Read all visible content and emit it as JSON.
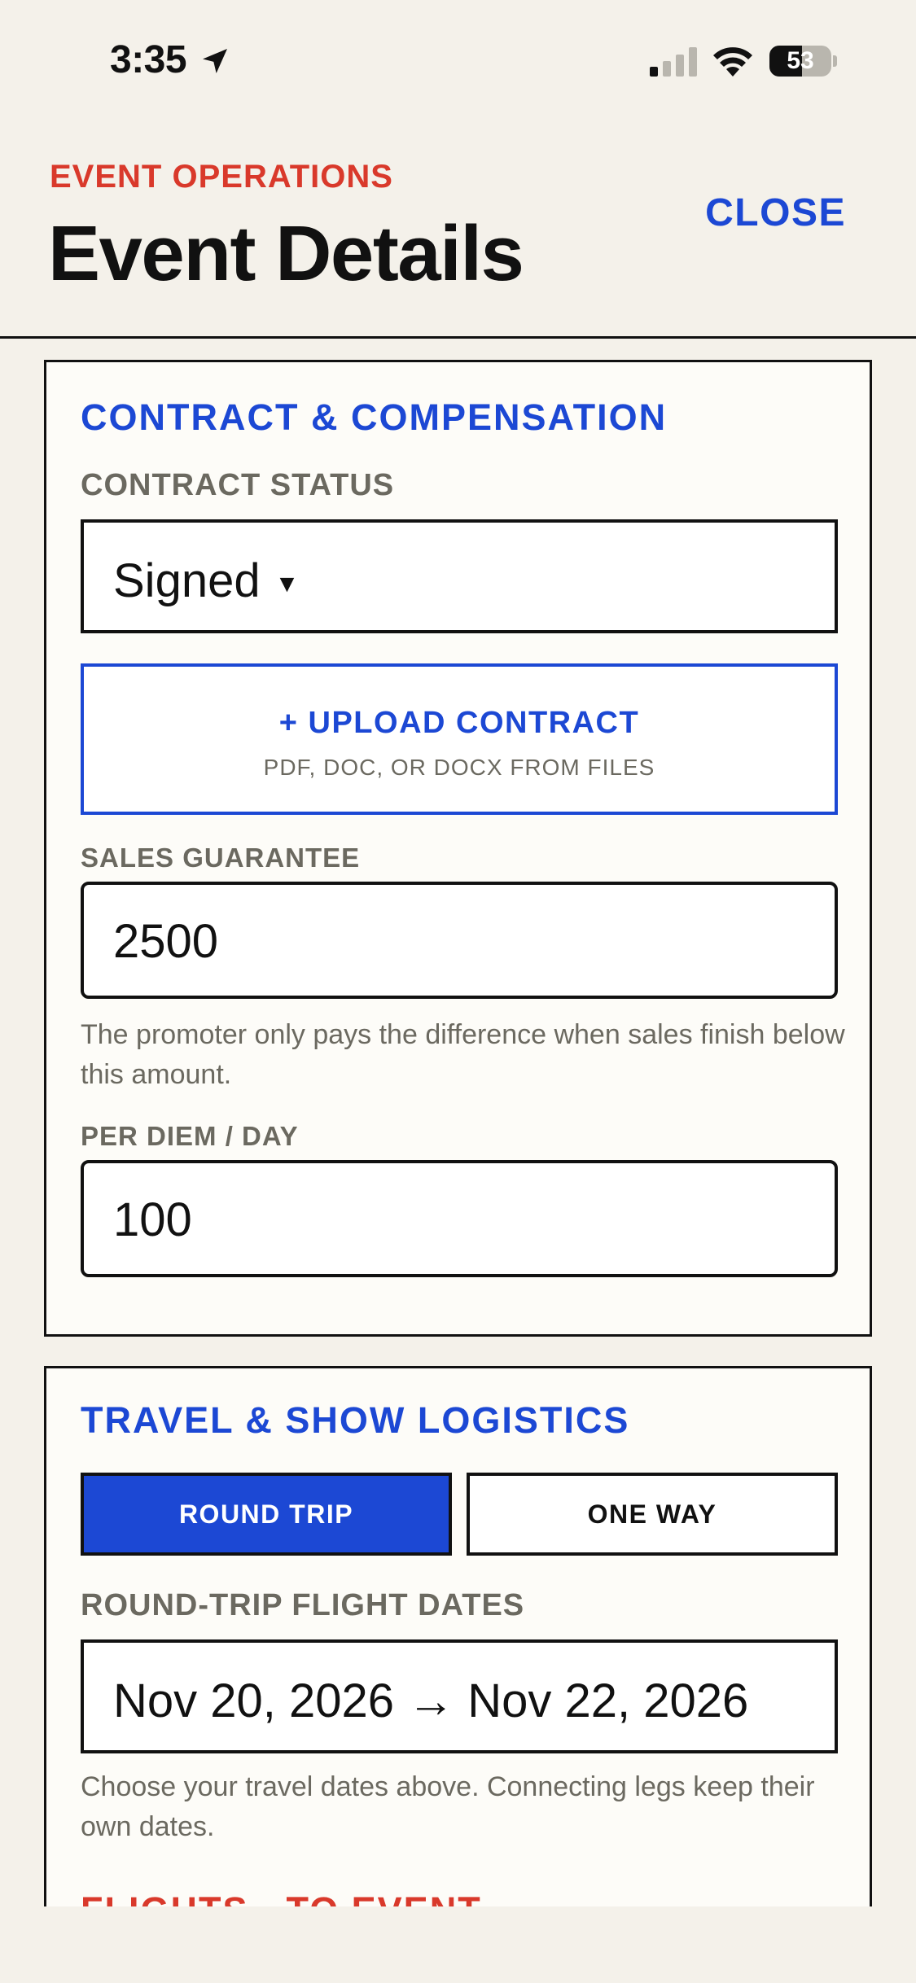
{
  "status_bar": {
    "time": "3:35",
    "battery": "53",
    "battery_level": 0.53,
    "icons": [
      "location-arrow-icon",
      "cellular-signal-icon",
      "wifi-icon",
      "battery-icon"
    ]
  },
  "header": {
    "eyebrow": "EVENT OPERATIONS",
    "title": "Event Details",
    "close_label": "CLOSE"
  },
  "contract": {
    "section_title": "CONTRACT & COMPENSATION",
    "status_label": "CONTRACT STATUS",
    "status_value": "Signed",
    "upload_title": "+ UPLOAD CONTRACT",
    "upload_subtitle": "PDF, DOC, OR DOCX FROM FILES",
    "guarantee_label": "SALES GUARANTEE",
    "guarantee_value": "2500",
    "guarantee_helper": "The promoter only pays the difference when sales finish below this amount.",
    "per_diem_label": "PER DIEM / DAY",
    "per_diem_value": "100"
  },
  "travel": {
    "section_title": "TRAVEL & SHOW LOGISTICS",
    "round_trip_label": "ROUND TRIP",
    "one_way_label": "ONE WAY",
    "selected_trip_type": "ROUND TRIP",
    "dates_label": "ROUND-TRIP FLIGHT DATES",
    "dates_value": "Nov 20, 2026 → Nov 22, 2026",
    "dates_helper": "Choose your travel dates above. Connecting legs keep their own dates.",
    "flights_heading": "FLIGHTS · TO EVENT"
  },
  "colors": {
    "accent_blue": "#1c48d4",
    "accent_red": "#d9392b",
    "background": "#f4f1ea",
    "muted_text": "#6b6960"
  }
}
